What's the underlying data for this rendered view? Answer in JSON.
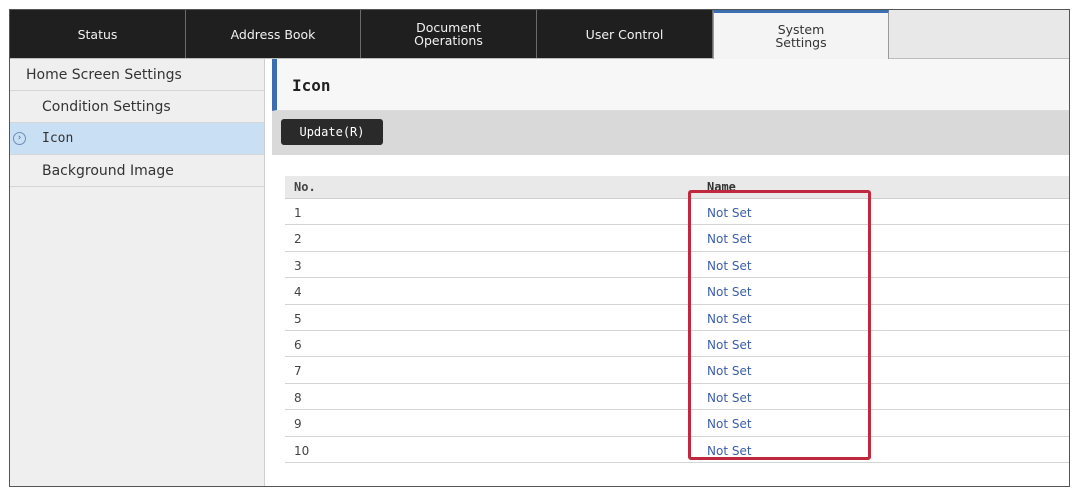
{
  "tabs": [
    {
      "label_line1": "Status",
      "label_line2": "",
      "active": false
    },
    {
      "label_line1": "Address Book",
      "label_line2": "",
      "active": false
    },
    {
      "label_line1": "Document",
      "label_line2": "Operations",
      "active": false
    },
    {
      "label_line1": "User Control",
      "label_line2": "",
      "active": false
    },
    {
      "label_line1": "System",
      "label_line2": "Settings",
      "active": true
    }
  ],
  "sidebar": {
    "items": [
      {
        "label": "Home Screen Settings"
      },
      {
        "label": "Condition Settings"
      },
      {
        "label": "Icon",
        "bullet": "›"
      },
      {
        "label": "Background Image"
      }
    ]
  },
  "main": {
    "title": "Icon",
    "update_button": "Update(R)",
    "table": {
      "headers": {
        "no": "No.",
        "name": "Name"
      },
      "rows": [
        {
          "no": "1",
          "name": "Not Set"
        },
        {
          "no": "2",
          "name": "Not Set"
        },
        {
          "no": "3",
          "name": "Not Set"
        },
        {
          "no": "4",
          "name": "Not Set"
        },
        {
          "no": "5",
          "name": "Not Set"
        },
        {
          "no": "6",
          "name": "Not Set"
        },
        {
          "no": "7",
          "name": "Not Set"
        },
        {
          "no": "8",
          "name": "Not Set"
        },
        {
          "no": "9",
          "name": "Not Set"
        },
        {
          "no": "10",
          "name": "Not Set"
        }
      ]
    }
  },
  "colors": {
    "accent": "#3b6fb0",
    "highlight": "#c0283d",
    "link": "#3b5ea8"
  }
}
